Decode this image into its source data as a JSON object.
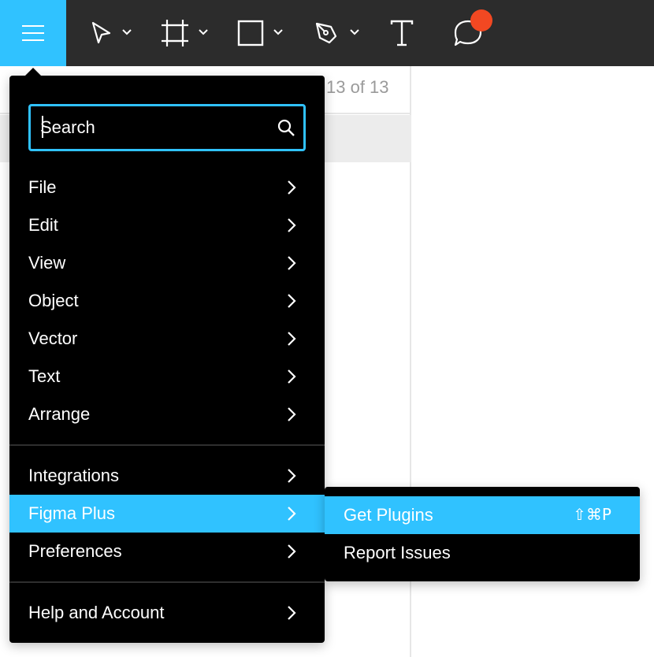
{
  "toolbar": {
    "tools": [
      {
        "icon": "main-menu-icon"
      },
      {
        "icon": "move-tool-icon",
        "has_dropdown": true
      },
      {
        "icon": "frame-tool-icon",
        "has_dropdown": true
      },
      {
        "icon": "rectangle-tool-icon",
        "has_dropdown": true
      },
      {
        "icon": "pen-tool-icon",
        "has_dropdown": true
      },
      {
        "icon": "text-tool-icon"
      },
      {
        "icon": "comment-tool-icon",
        "notification": true
      }
    ],
    "accent_color": "#30c2ff",
    "notification_color": "#f24822"
  },
  "background": {
    "counter": "13 of 13"
  },
  "menu": {
    "search": {
      "placeholder": "Search",
      "value": ""
    },
    "items": [
      {
        "label": "File"
      },
      {
        "label": "Edit"
      },
      {
        "label": "View"
      },
      {
        "label": "Object"
      },
      {
        "label": "Vector"
      },
      {
        "label": "Text"
      },
      {
        "label": "Arrange"
      },
      {
        "label": "Integrations"
      },
      {
        "label": "Figma Plus",
        "active": true
      },
      {
        "label": "Preferences"
      },
      {
        "label": "Help and Account"
      }
    ]
  },
  "submenu": {
    "items": [
      {
        "label": "Get Plugins",
        "shortcut": "⇧⌘P",
        "active": true
      },
      {
        "label": "Report Issues"
      }
    ]
  }
}
